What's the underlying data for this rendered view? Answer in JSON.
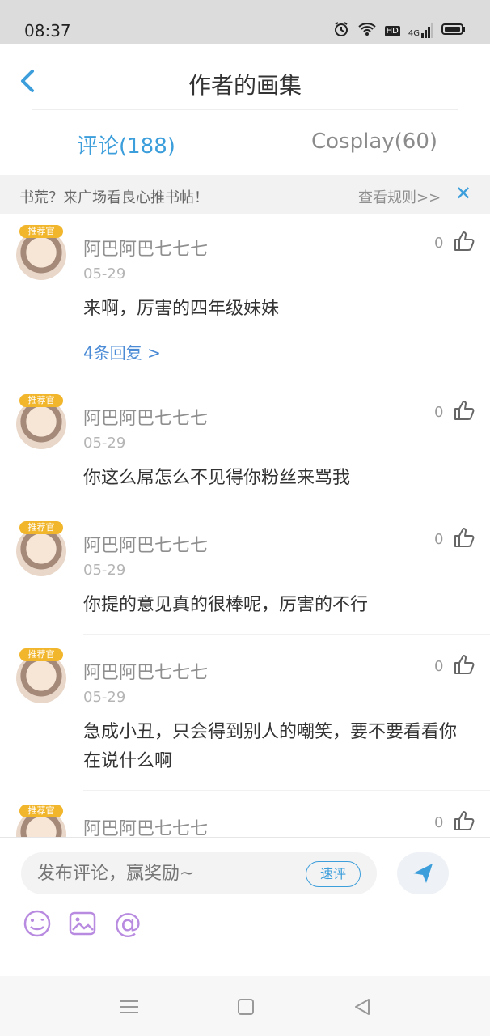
{
  "statusbar": {
    "time": "08:37",
    "icons": [
      "alarm-icon",
      "wifi-icon",
      "hd-icon",
      "4g-signal-icon",
      "battery-icon"
    ],
    "hd_label": "HD",
    "net_label": "4G"
  },
  "header": {
    "title": "作者的画集"
  },
  "tabs": [
    {
      "label": "评论(188)",
      "active": true
    },
    {
      "label": "Cosplay(60)",
      "active": false
    }
  ],
  "notice": {
    "text": "书荒？来广场看良心推书帖！",
    "link": "查看规则>>",
    "close": "✕"
  },
  "comments": [
    {
      "user": "阿巴阿巴七七七",
      "badge": "推荐官",
      "date": "05-29",
      "text": "来啊，厉害的四年级妹妹",
      "replies": "4条回复 >",
      "likes": "0"
    },
    {
      "user": "阿巴阿巴七七七",
      "badge": "推荐官",
      "date": "05-29",
      "text": "你这么屌怎么不见得你粉丝来骂我",
      "likes": "0"
    },
    {
      "user": "阿巴阿巴七七七",
      "badge": "推荐官",
      "date": "05-29",
      "text": "你提的意见真的很棒呢，厉害的不行",
      "likes": "0"
    },
    {
      "user": "阿巴阿巴七七七",
      "badge": "推荐官",
      "date": "05-29",
      "text": "急成小丑，只会得到别人的嘲笑，要不要看看你在说什么啊",
      "likes": "0"
    },
    {
      "user": "阿巴阿巴七七七",
      "badge": "推荐官",
      "likes": "0"
    }
  ],
  "composer": {
    "placeholder": "发布评论，赢奖励~",
    "quick_review": "速评",
    "tools": [
      "emoji-icon",
      "image-icon",
      "at-icon"
    ],
    "at_symbol": "@"
  },
  "colors": {
    "accent": "#3c9edb",
    "link": "#4b8bd6",
    "muted": "#8f8f8f",
    "notice_bg": "#f2f2f2"
  }
}
